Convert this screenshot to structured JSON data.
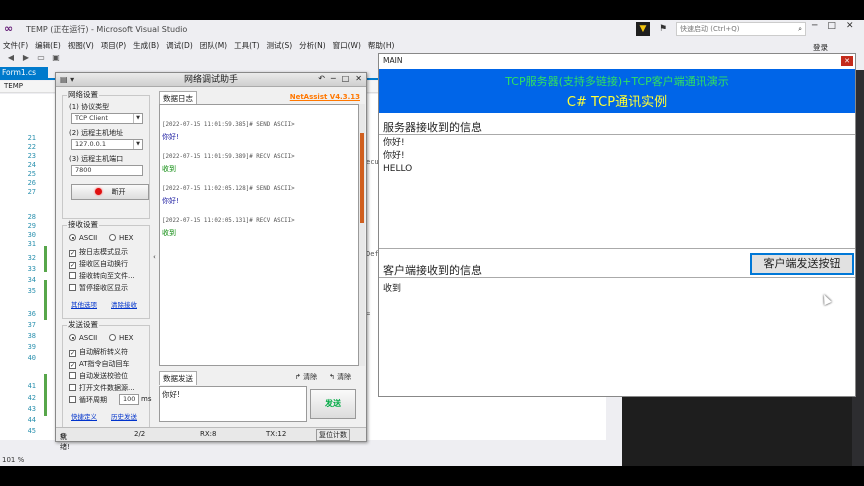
{
  "vs": {
    "title": "TEMP (正在运行) - Microsoft Visual Studio",
    "quick_launch": "快速启动 (Ctrl+Q)",
    "menu": [
      "文件(F)",
      "编辑(E)",
      "视图(V)",
      "项目(P)",
      "生成(B)",
      "调试(D)",
      "团队(M)",
      "工具(T)",
      "测试(S)",
      "分析(N)",
      "窗口(W)",
      "帮助(H)"
    ],
    "login": "登录",
    "doc_tab": "Form1.cs",
    "nav_item": "TEMP",
    "line_numbers": [
      "21",
      "22",
      "23",
      "24",
      "25",
      "26",
      "27",
      "28",
      "29",
      "30",
      "31",
      "32",
      "33",
      "34",
      "35",
      "36",
      "37",
      "38",
      "39",
      "40",
      "41",
      "42",
      "43",
      "44",
      "45",
      "46",
      "47"
    ],
    "code_fragments": [
      "ecu",
      "Def",
      "=",
      "}"
    ],
    "zoom": "101 %"
  },
  "netassist": {
    "title": "网络调试助手",
    "version": "NetAssist V4.3.13",
    "net_settings": {
      "group": "网络设置",
      "protocol_label": "(1) 协议类型",
      "protocol_value": "TCP Client",
      "host_label": "(2) 远程主机地址",
      "host_value": "127.0.0.1",
      "port_label": "(3) 远程主机端口",
      "port_value": "7800",
      "open_button": "断开"
    },
    "recv_settings": {
      "group": "接收设置",
      "ascii": "ASCII",
      "hex": "HEX",
      "options": [
        {
          "label": "按日志模式显示",
          "checked": true
        },
        {
          "label": "接收区自动换行",
          "checked": true
        },
        {
          "label": "接收转向至文件...",
          "checked": false
        },
        {
          "label": "暂停接收区显示",
          "checked": false
        }
      ],
      "link_save": "其他选项",
      "link_clear": "清除接收"
    },
    "send_settings": {
      "group": "发送设置",
      "ascii": "ASCII",
      "hex": "HEX",
      "options": [
        {
          "label": "自动解析转义符",
          "checked": true
        },
        {
          "label": "AT指令自动回车",
          "checked": true
        },
        {
          "label": "自动发送校验位",
          "checked": false
        },
        {
          "label": "打开文件数据源...",
          "checked": false
        },
        {
          "label": "循环周期",
          "checked": false
        }
      ],
      "interval": "100",
      "interval_unit": "ms",
      "link_shortcut": "快捷定义",
      "link_history": "历史发送"
    },
    "log_tab": "数据日志",
    "log": [
      {
        "header": "[2022-07-15 11:01:59.385]# SEND ASCII>",
        "msg": "你好!",
        "kind": "send"
      },
      {
        "header": "[2022-07-15 11:01:59.389]# RECV ASCII>",
        "msg": "收到",
        "kind": "recv"
      },
      {
        "header": "[2022-07-15 11:02:05.128]# SEND ASCII>",
        "msg": "你好!",
        "kind": "send"
      },
      {
        "header": "[2022-07-15 11:02:05.131]# RECV ASCII>",
        "msg": "收到",
        "kind": "recv"
      }
    ],
    "send_tab": "数据发送",
    "clear1": "清除",
    "clear2": "清除",
    "send_text": "你好!",
    "send_button": "发送",
    "status": {
      "state": "就绪!",
      "count": "2/2",
      "rx": "RX:8",
      "tx": "TX:12",
      "reset": "复位计数"
    },
    "colors": {
      "send": "#1a1aa0",
      "recv": "#0a8a0a",
      "version": "#ff7700"
    }
  },
  "main": {
    "title": "MAIN",
    "banner_line1": "TCP服务器(支持多链接)+TCP客户端通讯演示",
    "banner_line2": "C# TCP通讯实例",
    "server_label": "服务器接收到的信息",
    "server_lines": [
      "你好!",
      "你好!",
      "HELLO"
    ],
    "client_label": "客户端接收到的信息",
    "client_button": "客户端发送按钮",
    "client_text": "收到",
    "colors": {
      "banner": "#0065e8",
      "line1": "#30e060",
      "line2": "#ffff33"
    }
  }
}
